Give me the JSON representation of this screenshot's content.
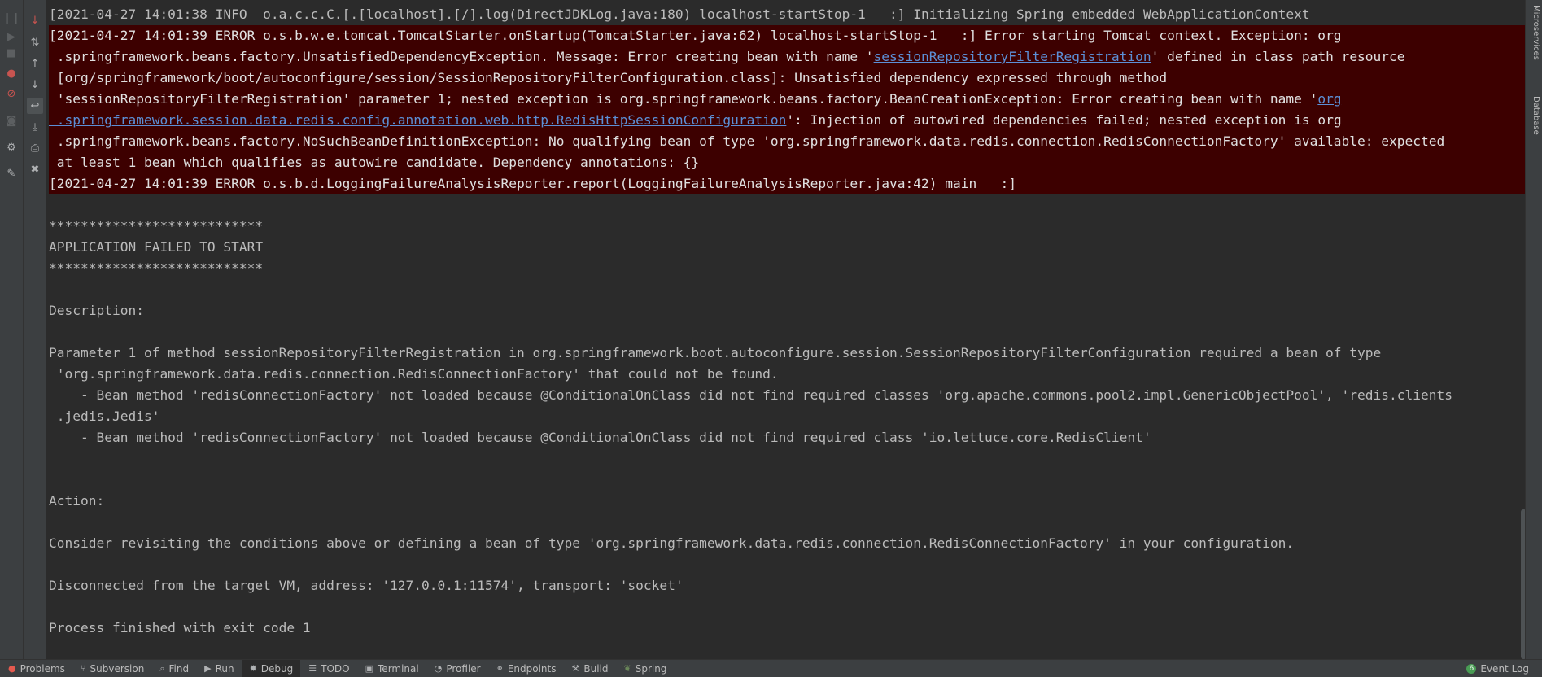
{
  "toolbar_left_primary": {
    "buttons": [
      {
        "name": "rerun-icon",
        "glyph": "❙❙"
      },
      {
        "name": "resume-icon",
        "glyph": "▶"
      },
      {
        "name": "stop-icon",
        "glyph": "■"
      },
      {
        "name": "view-breakpoints-icon",
        "glyph": "●"
      },
      {
        "name": "mute-breakpoints-icon",
        "glyph": "⊘"
      },
      {
        "name": "get-thread-dump-icon",
        "glyph": "◙"
      },
      {
        "name": "settings-icon",
        "glyph": "⚙"
      },
      {
        "name": "pin-tab-icon",
        "glyph": "📌"
      }
    ]
  },
  "toolbar_left_secondary": {
    "buttons": [
      {
        "name": "step-over-icon",
        "glyph": "↧"
      },
      {
        "name": "step-into-icon",
        "glyph": "↓"
      },
      {
        "name": "sort-icon",
        "glyph": "⇅"
      },
      {
        "name": "up-icon",
        "glyph": "↑"
      },
      {
        "name": "down-icon",
        "glyph": "↓"
      },
      {
        "name": "soft-wrap-icon",
        "glyph": "↩"
      },
      {
        "name": "scroll-to-end-icon",
        "glyph": "⤓"
      },
      {
        "name": "print-icon",
        "glyph": "⎙"
      },
      {
        "name": "clear-all-icon",
        "glyph": "🗑"
      }
    ]
  },
  "right_strip": {
    "tabs": [
      "Microservices",
      "Database"
    ]
  },
  "console": {
    "line_info": "[2021-04-27 14:01:38 INFO  o.a.c.c.C.[.[localhost].[/].log(DirectJDKLog.java:180) localhost-startStop-1   :] Initializing Spring embedded WebApplicationContext",
    "err1_a": "[2021-04-27 14:01:39 ERROR o.s.b.w.e.tomcat.TomcatStarter.onStartup(TomcatStarter.java:62) localhost-startStop-1   :] Error starting Tomcat context. Exception: org",
    "err1_b_pre": " .springframework.beans.factory.UnsatisfiedDependencyException. Message: Error creating bean with name '",
    "err1_b_link": "sessionRepositoryFilterRegistration",
    "err1_b_post": "' defined in class path resource",
    "err1_c": " [org/springframework/boot/autoconfigure/session/SessionRepositoryFilterConfiguration.class]: Unsatisfied dependency expressed through method",
    "err1_d_pre": " 'sessionRepositoryFilterRegistration' parameter 1; nested exception is org.springframework.beans.factory.BeanCreationException: Error creating bean with name '",
    "err1_d_link": "org",
    "err1_e_link": " .springframework.session.data.redis.config.annotation.web.http.RedisHttpSessionConfiguration",
    "err1_e_post": "': Injection of autowired dependencies failed; nested exception is org",
    "err1_f": " .springframework.beans.factory.NoSuchBeanDefinitionException: No qualifying bean of type 'org.springframework.data.redis.connection.RedisConnectionFactory' available: expected",
    "err1_g": " at least 1 bean which qualifies as autowire candidate. Dependency annotations: {}",
    "err2": "[2021-04-27 14:01:39 ERROR o.s.b.d.LoggingFailureAnalysisReporter.report(LoggingFailureAnalysisReporter.java:42) main   :]",
    "stars1": "***************************",
    "failed": "APPLICATION FAILED TO START",
    "stars2": "***************************",
    "description_label": "Description:",
    "param_a": "Parameter 1 of method sessionRepositoryFilterRegistration in org.springframework.boot.autoconfigure.session.SessionRepositoryFilterConfiguration required a bean of type",
    "param_b": " 'org.springframework.data.redis.connection.RedisConnectionFactory' that could not be found.",
    "bean1_a": "    - Bean method 'redisConnectionFactory' not loaded because @ConditionalOnClass did not find required classes 'org.apache.commons.pool2.impl.GenericObjectPool', 'redis.clients",
    "bean1_b": " .jedis.Jedis'",
    "bean2": "    - Bean method 'redisConnectionFactory' not loaded because @ConditionalOnClass did not find required class 'io.lettuce.core.RedisClient'",
    "action_label": "Action:",
    "consider": "Consider revisiting the conditions above or defining a bean of type 'org.springframework.data.redis.connection.RedisConnectionFactory' in your configuration.",
    "disconnected": "Disconnected from the target VM, address: '127.0.0.1:11574', transport: 'socket'",
    "process": "Process finished with exit code 1"
  },
  "bottom_bar": {
    "tabs": [
      {
        "key": "problems",
        "label": "Problems",
        "icon": "error-circle-icon",
        "glyph": "●"
      },
      {
        "key": "subversion",
        "label": "Subversion",
        "icon": "vcs-branch-icon",
        "glyph": "⑂"
      },
      {
        "key": "find",
        "label": "Find",
        "icon": "search-icon",
        "glyph": "🔍"
      },
      {
        "key": "run",
        "label": "Run",
        "icon": "run-icon",
        "glyph": "▶"
      },
      {
        "key": "debug",
        "label": "Debug",
        "icon": "bug-icon",
        "glyph": "✹"
      },
      {
        "key": "todo",
        "label": "TODO",
        "icon": "list-icon",
        "glyph": "☰"
      },
      {
        "key": "terminal",
        "label": "Terminal",
        "icon": "terminal-icon",
        "glyph": "▣"
      },
      {
        "key": "profiler",
        "label": "Profiler",
        "icon": "profiler-icon",
        "glyph": "◔"
      },
      {
        "key": "endpoints",
        "label": "Endpoints",
        "icon": "endpoints-icon",
        "glyph": "⚭"
      },
      {
        "key": "build",
        "label": "Build",
        "icon": "hammer-icon",
        "glyph": "⚒"
      },
      {
        "key": "spring",
        "label": "Spring",
        "icon": "spring-leaf-icon",
        "glyph": "❦"
      }
    ],
    "active_tab": "Debug",
    "event_log": {
      "label": "Event Log",
      "count": "6"
    }
  },
  "colors": {
    "background": "#2b2b2b",
    "error_background": "#3d0000",
    "text": "#bbbbbb",
    "link": "#5c8fd6",
    "panel": "#3c3f41"
  }
}
